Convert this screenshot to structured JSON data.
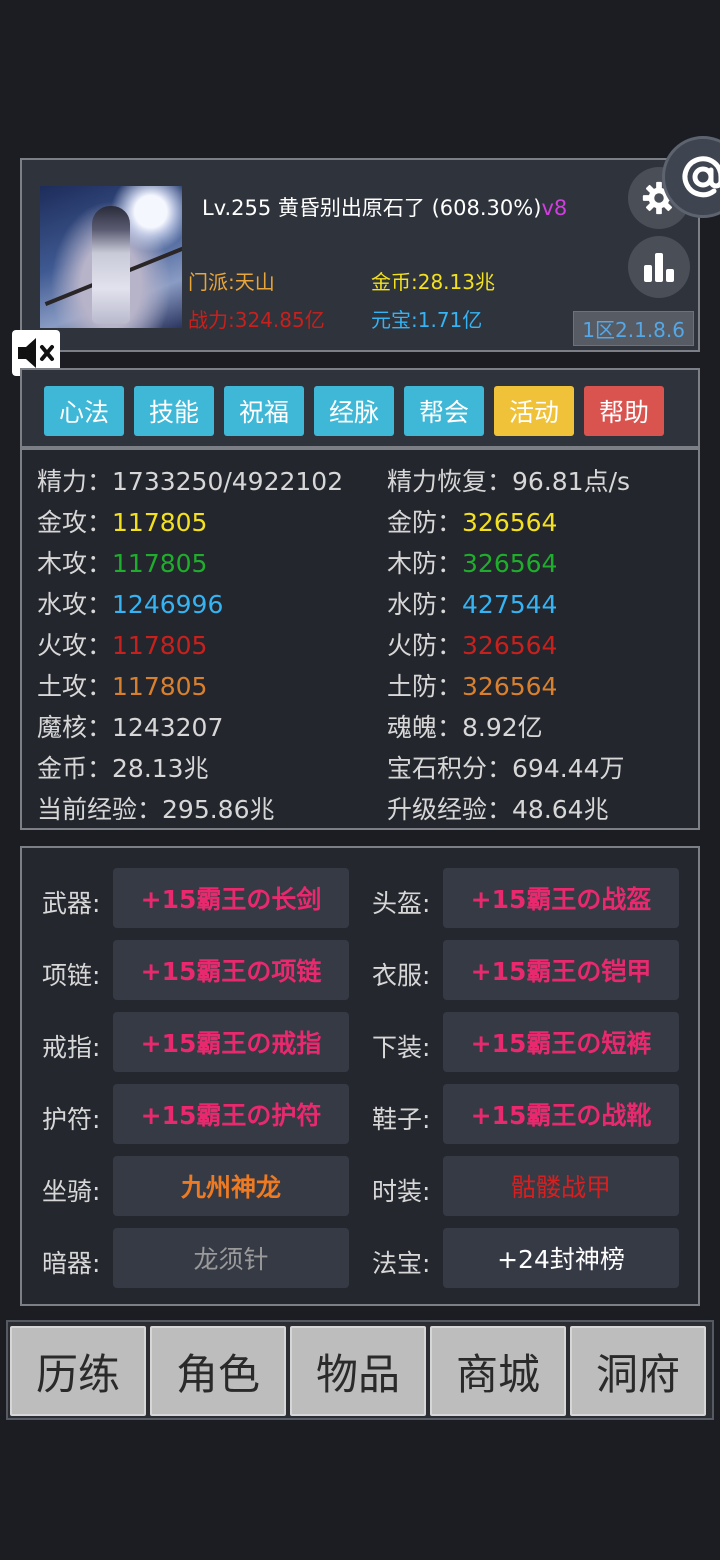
{
  "header": {
    "level_title": "Lv.255 黄昏别出原石了 (608.30%)",
    "version_badge": "v8",
    "sect": "门派:天山",
    "gold": "金币:28.13兆",
    "power": "战力:324.85亿",
    "ingot": "元宝:1.71亿",
    "server": "1区2.1.8.6"
  },
  "tabs": [
    {
      "label": "心法",
      "color": "#3fb8d8"
    },
    {
      "label": "技能",
      "color": "#3fb8d8"
    },
    {
      "label": "祝福",
      "color": "#3fb8d8"
    },
    {
      "label": "经脉",
      "color": "#3fb8d8"
    },
    {
      "label": "帮会",
      "color": "#3fb8d8"
    },
    {
      "label": "活动",
      "color": "#f0c23a"
    },
    {
      "label": "帮助",
      "color": "#d9534f"
    }
  ],
  "stats": {
    "stamina_label": "精力：",
    "stamina": "1733250/4922102",
    "stamina_regen_label": "精力恢复：",
    "stamina_regen": "96.81点/s",
    "metal_atk_label": "金攻：",
    "metal_atk": "117805",
    "metal_def_label": "金防：",
    "metal_def": "326564",
    "wood_atk_label": "木攻：",
    "wood_atk": "117805",
    "wood_def_label": "木防：",
    "wood_def": "326564",
    "water_atk_label": "水攻：",
    "water_atk": "1246996",
    "water_def_label": "水防：",
    "water_def": "427544",
    "fire_atk_label": "火攻：",
    "fire_atk": "117805",
    "fire_def_label": "火防：",
    "fire_def": "326564",
    "earth_atk_label": "土攻：",
    "earth_atk": "117805",
    "earth_def_label": "土防：",
    "earth_def": "326564",
    "magic_core_label": "魔核：",
    "magic_core": "1243207",
    "soul_label": "魂魄：",
    "soul": "8.92亿",
    "gold_label": "金币：",
    "gold": "28.13兆",
    "gem_points_label": "宝石积分：",
    "gem_points": "694.44万",
    "cur_exp_label": "当前经验：",
    "cur_exp": "295.86兆",
    "next_exp_label": "升级经验：",
    "next_exp": "48.64兆",
    "colors": {
      "metal": "#f3e01f",
      "wood": "#1fae2c",
      "water": "#35b3f2",
      "fire": "#c8201c",
      "earth": "#d9802e"
    }
  },
  "equipment": [
    {
      "slot": "武器:",
      "item": "+15霸王の长剑",
      "color": "#e8296e"
    },
    {
      "slot": "头盔:",
      "item": "+15霸王の战盔",
      "color": "#e8296e"
    },
    {
      "slot": "项链:",
      "item": "+15霸王の项链",
      "color": "#e8296e"
    },
    {
      "slot": "衣服:",
      "item": "+15霸王の铠甲",
      "color": "#e8296e"
    },
    {
      "slot": "戒指:",
      "item": "+15霸王の戒指",
      "color": "#e8296e"
    },
    {
      "slot": "下装:",
      "item": "+15霸王の短裤",
      "color": "#e8296e"
    },
    {
      "slot": "护符:",
      "item": "+15霸王の护符",
      "color": "#e8296e"
    },
    {
      "slot": "鞋子:",
      "item": "+15霸王の战靴",
      "color": "#e8296e"
    },
    {
      "slot": "坐骑:",
      "item": "九州神龙",
      "color": "#ee7a22"
    },
    {
      "slot": "时装:",
      "item": "骷髅战甲",
      "color": "#d81f1f"
    },
    {
      "slot": "暗器:",
      "item": "龙须针",
      "color": "#9a9a9a"
    },
    {
      "slot": "法宝:",
      "item": "+24封神榜",
      "color": "#ffffff"
    }
  ],
  "nav": [
    "历练",
    "角色",
    "物品",
    "商城",
    "洞府"
  ],
  "icons": {
    "settings": "gear-icon",
    "ranking": "bar-chart-icon",
    "mail": "at-icon",
    "sound": "mute-icon"
  }
}
